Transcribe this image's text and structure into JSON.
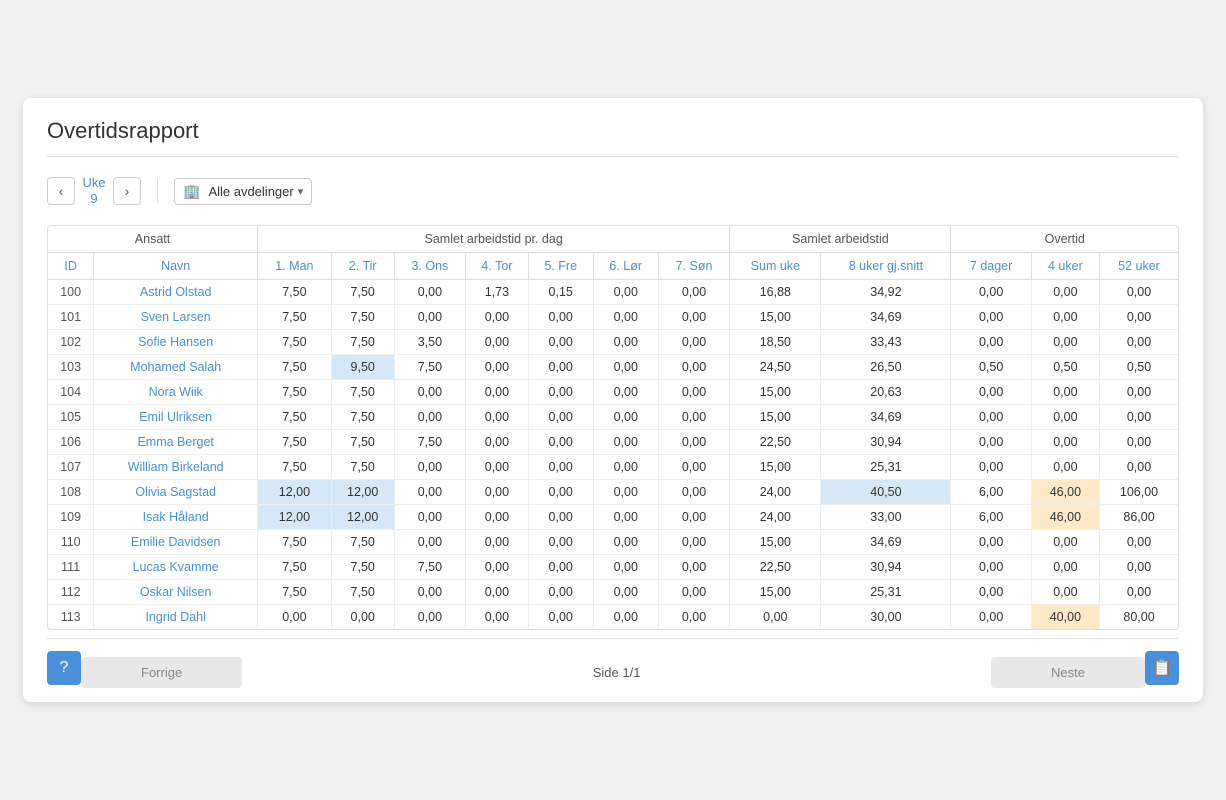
{
  "title": "Overtidsrapport",
  "week": {
    "label": "Uke",
    "number": "9",
    "prev_label": "‹",
    "next_label": "›"
  },
  "department": {
    "label": "Alle avdelinger",
    "icon": "🏢"
  },
  "table": {
    "group_headers": [
      {
        "label": "Ansatt",
        "colspan": 2
      },
      {
        "label": "Samlet arbeidstid pr. dag",
        "colspan": 7
      },
      {
        "label": "Samlet arbeidstid",
        "colspan": 2
      },
      {
        "label": "Overtid",
        "colspan": 3
      }
    ],
    "col_headers": [
      {
        "label": "ID"
      },
      {
        "label": "Navn"
      },
      {
        "label": "1. Man"
      },
      {
        "label": "2. Tir"
      },
      {
        "label": "3. Ons"
      },
      {
        "label": "4. Tor"
      },
      {
        "label": "5. Fre"
      },
      {
        "label": "6. Lør"
      },
      {
        "label": "7. Søn"
      },
      {
        "label": "Sum uke"
      },
      {
        "label": "8 uker gj.snitt"
      },
      {
        "label": "7 dager"
      },
      {
        "label": "4 uker"
      },
      {
        "label": "52 uker"
      }
    ],
    "rows": [
      {
        "id": "100",
        "name": "Astrid Olstad",
        "man": "7,50",
        "tir": "7,50",
        "ons": "0,00",
        "tor": "1,73",
        "fre": "0,15",
        "lor": "0,00",
        "son": "0,00",
        "sum": "16,88",
        "gj": "34,92",
        "d7": "0,00",
        "u4": "0,00",
        "u52": "0,00",
        "highlight_man": false,
        "highlight_tir": false,
        "highlight_u4": false,
        "highlight_u52": false
      },
      {
        "id": "101",
        "name": "Sven Larsen",
        "man": "7,50",
        "tir": "7,50",
        "ons": "0,00",
        "tor": "0,00",
        "fre": "0,00",
        "lor": "0,00",
        "son": "0,00",
        "sum": "15,00",
        "gj": "34,69",
        "d7": "0,00",
        "u4": "0,00",
        "u52": "0,00",
        "highlight_man": false,
        "highlight_tir": false,
        "highlight_u4": false,
        "highlight_u52": false
      },
      {
        "id": "102",
        "name": "Sofie Hansen",
        "man": "7,50",
        "tir": "7,50",
        "ons": "3,50",
        "tor": "0,00",
        "fre": "0,00",
        "lor": "0,00",
        "son": "0,00",
        "sum": "18,50",
        "gj": "33,43",
        "d7": "0,00",
        "u4": "0,00",
        "u52": "0,00",
        "highlight_man": false,
        "highlight_tir": false,
        "highlight_u4": false,
        "highlight_u52": false
      },
      {
        "id": "103",
        "name": "Mohamed Salah",
        "man": "7,50",
        "tir": "9,50",
        "ons": "7,50",
        "tor": "0,00",
        "fre": "0,00",
        "lor": "0,00",
        "son": "0,00",
        "sum": "24,50",
        "gj": "26,50",
        "d7": "0,50",
        "u4": "0,50",
        "u52": "0,50",
        "highlight_man": false,
        "highlight_tir": true,
        "highlight_u4": false,
        "highlight_u52": false
      },
      {
        "id": "104",
        "name": "Nora Wiik",
        "man": "7,50",
        "tir": "7,50",
        "ons": "0,00",
        "tor": "0,00",
        "fre": "0,00",
        "lor": "0,00",
        "son": "0,00",
        "sum": "15,00",
        "gj": "20,63",
        "d7": "0,00",
        "u4": "0,00",
        "u52": "0,00",
        "highlight_man": false,
        "highlight_tir": false,
        "highlight_u4": false,
        "highlight_u52": false
      },
      {
        "id": "105",
        "name": "Emil Ulriksen",
        "man": "7,50",
        "tir": "7,50",
        "ons": "0,00",
        "tor": "0,00",
        "fre": "0,00",
        "lor": "0,00",
        "son": "0,00",
        "sum": "15,00",
        "gj": "34,69",
        "d7": "0,00",
        "u4": "0,00",
        "u52": "0,00",
        "highlight_man": false,
        "highlight_tir": false,
        "highlight_u4": false,
        "highlight_u52": false
      },
      {
        "id": "106",
        "name": "Emma Berget",
        "man": "7,50",
        "tir": "7,50",
        "ons": "7,50",
        "tor": "0,00",
        "fre": "0,00",
        "lor": "0,00",
        "son": "0,00",
        "sum": "22,50",
        "gj": "30,94",
        "d7": "0,00",
        "u4": "0,00",
        "u52": "0,00",
        "highlight_man": false,
        "highlight_tir": false,
        "highlight_u4": false,
        "highlight_u52": false
      },
      {
        "id": "107",
        "name": "William Birkeland",
        "man": "7,50",
        "tir": "7,50",
        "ons": "0,00",
        "tor": "0,00",
        "fre": "0,00",
        "lor": "0,00",
        "son": "0,00",
        "sum": "15,00",
        "gj": "25,31",
        "d7": "0,00",
        "u4": "0,00",
        "u52": "0,00",
        "highlight_man": false,
        "highlight_tir": false,
        "highlight_u4": false,
        "highlight_u52": false
      },
      {
        "id": "108",
        "name": "Olivia Sagstad",
        "man": "12,00",
        "tir": "12,00",
        "ons": "0,00",
        "tor": "0,00",
        "fre": "0,00",
        "lor": "0,00",
        "son": "0,00",
        "sum": "24,00",
        "gj": "40,50",
        "d7": "6,00",
        "u4": "46,00",
        "u52": "106,00",
        "highlight_man": true,
        "highlight_tir": true,
        "highlight_gj": true,
        "highlight_u4": true,
        "highlight_u52": false
      },
      {
        "id": "109",
        "name": "Isak Håland",
        "man": "12,00",
        "tir": "12,00",
        "ons": "0,00",
        "tor": "0,00",
        "fre": "0,00",
        "lor": "0,00",
        "son": "0,00",
        "sum": "24,00",
        "gj": "33,00",
        "d7": "6,00",
        "u4": "46,00",
        "u52": "86,00",
        "highlight_man": true,
        "highlight_tir": true,
        "highlight_gj": false,
        "highlight_u4": true,
        "highlight_u52": false
      },
      {
        "id": "110",
        "name": "Emilie Davidsen",
        "man": "7,50",
        "tir": "7,50",
        "ons": "0,00",
        "tor": "0,00",
        "fre": "0,00",
        "lor": "0,00",
        "son": "0,00",
        "sum": "15,00",
        "gj": "34,69",
        "d7": "0,00",
        "u4": "0,00",
        "u52": "0,00",
        "highlight_man": false,
        "highlight_tir": false,
        "highlight_u4": false,
        "highlight_u52": false
      },
      {
        "id": "111",
        "name": "Lucas Kvamme",
        "man": "7,50",
        "tir": "7,50",
        "ons": "7,50",
        "tor": "0,00",
        "fre": "0,00",
        "lor": "0,00",
        "son": "0,00",
        "sum": "22,50",
        "gj": "30,94",
        "d7": "0,00",
        "u4": "0,00",
        "u52": "0,00",
        "highlight_man": false,
        "highlight_tir": false,
        "highlight_u4": false,
        "highlight_u52": false
      },
      {
        "id": "112",
        "name": "Oskar Nilsen",
        "man": "7,50",
        "tir": "7,50",
        "ons": "0,00",
        "tor": "0,00",
        "fre": "0,00",
        "lor": "0,00",
        "son": "0,00",
        "sum": "15,00",
        "gj": "25,31",
        "d7": "0,00",
        "u4": "0,00",
        "u52": "0,00",
        "highlight_man": false,
        "highlight_tir": false,
        "highlight_u4": false,
        "highlight_u52": false
      },
      {
        "id": "113",
        "name": "Ingrid Dahl",
        "man": "0,00",
        "tir": "0,00",
        "ons": "0,00",
        "tor": "0,00",
        "fre": "0,00",
        "lor": "0,00",
        "son": "0,00",
        "sum": "0,00",
        "gj": "30,00",
        "d7": "0,00",
        "u4": "40,00",
        "u52": "80,00",
        "highlight_man": false,
        "highlight_tir": false,
        "highlight_u4": true,
        "highlight_u52": false
      }
    ]
  },
  "pagination": {
    "prev_label": "Forrige",
    "page_info": "Side 1/1",
    "next_label": "Neste"
  },
  "actions": {
    "help_icon": "?",
    "export_icon": "📋"
  }
}
